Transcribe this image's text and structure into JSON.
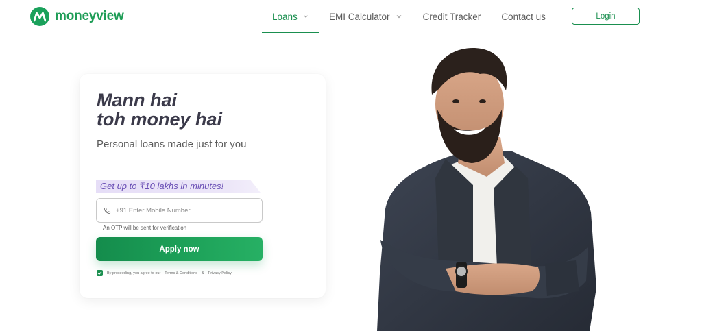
{
  "brand": {
    "name": "moneyview",
    "color": "#1a8f4f"
  },
  "nav": {
    "items": [
      {
        "label": "Loans",
        "active": true,
        "has_dropdown": true
      },
      {
        "label": "EMI Calculator",
        "active": false,
        "has_dropdown": true
      },
      {
        "label": "Credit Tracker",
        "active": false,
        "has_dropdown": false
      },
      {
        "label": "Contact us",
        "active": false,
        "has_dropdown": false
      }
    ],
    "login_label": "Login"
  },
  "hero": {
    "headline_line1": "Mann hai",
    "headline_line2": "toh money hai",
    "subheadline": "Personal loans made just for you",
    "promo": "Get up to ₹10 lakhs in minutes!"
  },
  "form": {
    "phone_placeholder": "+91 Enter Mobile Number",
    "phone_value": "",
    "otp_note": "An OTP will be sent for verification",
    "apply_label": "Apply now",
    "consent_prefix": "By proceeding, you agree to our",
    "terms_label": "Terms & Conditions",
    "consent_join": "&",
    "privacy_label": "Privacy Policy",
    "consent_checked": true
  },
  "icons": {
    "logo": "moneyview-logo-icon",
    "phone": "phone-icon",
    "chevron": "chevron-down-icon",
    "check": "check-icon"
  }
}
